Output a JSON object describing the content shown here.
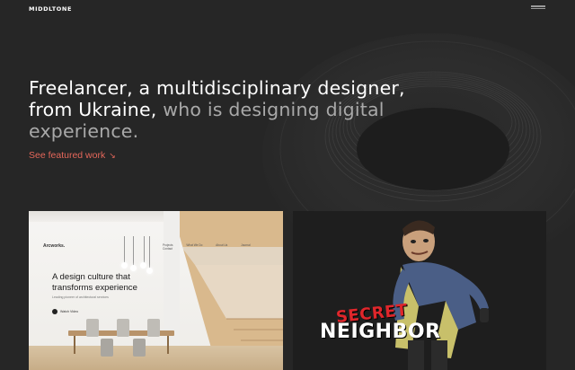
{
  "header": {
    "logo": "MIDDLTONE",
    "menu_icon": "hamburger-menu-icon"
  },
  "hero": {
    "line1": "Freelancer, a multidisciplinary designer,",
    "line2_white": "from Ukraine,",
    "line2_gray": " who is designing digital",
    "line3_gray": "experience."
  },
  "cta": {
    "label": "See featured work",
    "arrow": "↘",
    "color": "#e5675a"
  },
  "projects": [
    {
      "brand": "Arcworks.",
      "nav": [
        "Projects",
        "What We Do",
        "About Us",
        "Journal",
        "Contact"
      ],
      "headline_1": "A design culture that",
      "headline_2": "transforms experience",
      "subline": "Leading pioneer of architectural services",
      "button": "Watch Video"
    },
    {
      "title_top": "SECRET",
      "title_bottom": "NEIGHBOR"
    }
  ],
  "colors": {
    "background": "#262626",
    "accent": "#e5675a",
    "text_white": "#ffffff",
    "text_gray": "#a9a9a9"
  }
}
